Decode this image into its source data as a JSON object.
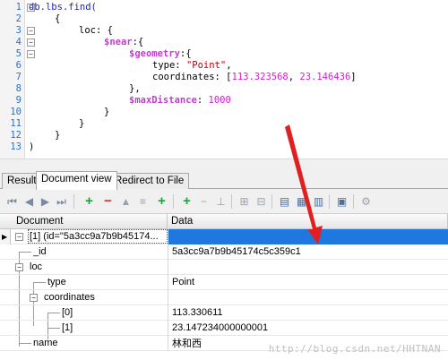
{
  "editor": {
    "line_numbers": [
      "1",
      "2",
      "3",
      "4",
      "5",
      "6",
      "7",
      "8",
      "9",
      "10",
      "11",
      "12",
      "13"
    ],
    "line1": "db.lbs.find(",
    "line2": "{",
    "line3": "loc: {",
    "line4_op": "$near",
    "line4_rest": ":{",
    "line5_op": "$geometry",
    "line5_rest": ":{",
    "line6_key": "type: ",
    "line6_val": "\"Point\"",
    "line6_end": ",",
    "line7_key": "coordinates: [",
    "line7_num1": "113.323568",
    "line7_sep": ", ",
    "line7_num2": "23.146436",
    "line7_end": "]",
    "line8": "},",
    "line9_op": "$maxDistance",
    "line9_rest": ": ",
    "line9_num": "1000",
    "line10": "}",
    "line11": "}",
    "line12": "}",
    "line13": ")"
  },
  "tabs": [
    "Result",
    "Document view",
    "Redirect to File"
  ],
  "grid": {
    "headers": [
      "Document",
      "Data"
    ],
    "root_label": "[1] (id=\"5a3cc9a7b9b45174...",
    "rows": [
      {
        "key": "_id",
        "value": "5a3cc9a7b9b45174c5c359c1"
      },
      {
        "key": "loc",
        "value": ""
      },
      {
        "key": "type",
        "value": "Point"
      },
      {
        "key": "coordinates",
        "value": ""
      },
      {
        "key": "[0]",
        "value": "113.330611"
      },
      {
        "key": "[1]",
        "value": "23.147234000000001"
      },
      {
        "key": "name",
        "value": "林和西"
      }
    ]
  },
  "watermark": "http://blog.csdn.net/HHTNAN",
  "colors": {
    "selection": "#1f78e0",
    "arrow": "#e02020",
    "operator": "#c43bd1"
  }
}
